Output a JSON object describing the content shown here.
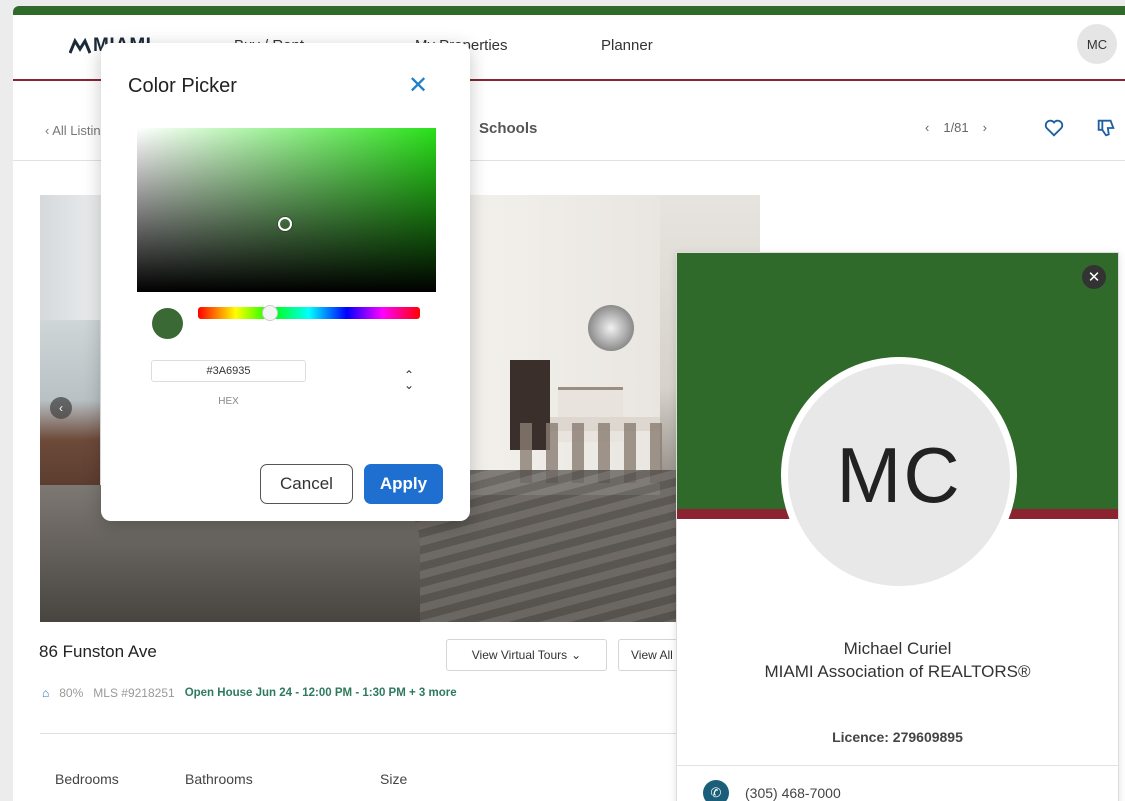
{
  "nav": {
    "logo": "MIAMI",
    "links": [
      "Buy / Rent",
      "My Properties",
      "Planner"
    ],
    "avatar_initials": "MC"
  },
  "subbar": {
    "back_label": "All Listings",
    "schools_tab": "Schools",
    "pager": "1/81"
  },
  "listing": {
    "address": "86 Funston Ave",
    "virtual_tours_button": "View Virtual Tours",
    "view_all_button": "View All",
    "match_percent": "80%",
    "mls": "MLS #9218251",
    "open_house": "Open House Jun 24 - 12:00 PM - 1:30 PM + 3 more",
    "stats": [
      "Bedrooms",
      "Bathrooms",
      "Size"
    ]
  },
  "profile": {
    "initials": "MC",
    "name": "Michael Curiel",
    "association": "MIAMI Association of REALTORS®",
    "license": "Licence: 279609895",
    "phone": "(305) 468-7000",
    "banner_color": "#2F6A2B",
    "stripe_color": "#8B2331"
  },
  "color_picker": {
    "title": "Color Picker",
    "hex_value": "#3A6935",
    "hex_label": "HEX",
    "cancel_label": "Cancel",
    "apply_label": "Apply",
    "selected_color": "#3A6935",
    "hue_position": 0.33
  },
  "colors": {
    "brand_green": "#2F6A2B",
    "brand_maroon": "#8B2331",
    "apply_blue": "#1F6FD0",
    "close_blue": "#1F7FC9"
  }
}
